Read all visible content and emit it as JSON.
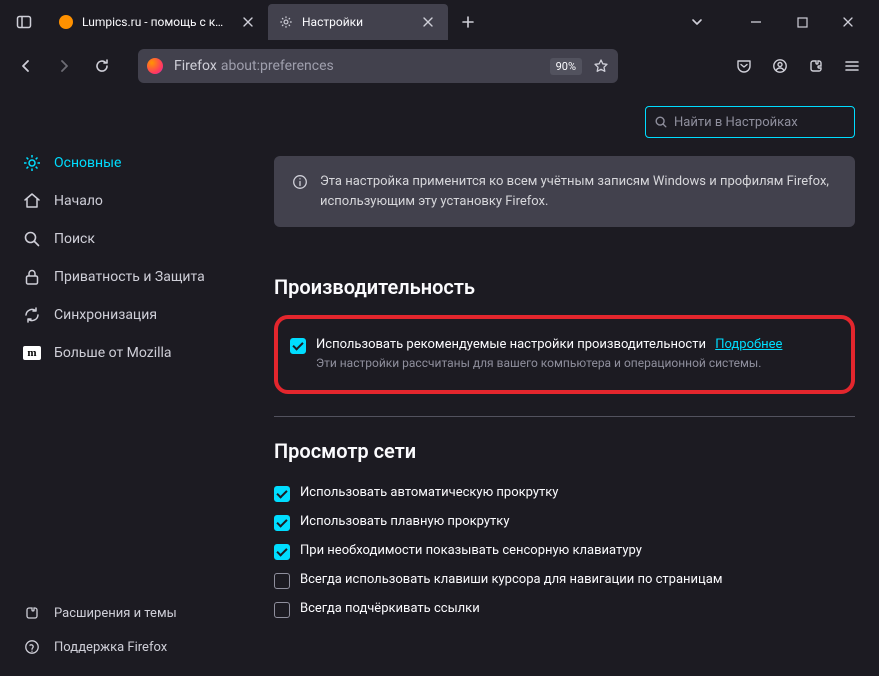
{
  "tabs": [
    {
      "label": "Lumpics.ru - помощь с компь",
      "icon": "orange"
    },
    {
      "label": "Настройки",
      "icon": "gear"
    }
  ],
  "urlbar": {
    "identity": "Firefox",
    "path": "about:preferences",
    "zoom": "90%"
  },
  "search": {
    "placeholder": "Найти в Настройках"
  },
  "categories": [
    {
      "id": "general",
      "label": "Основные",
      "icon": "gear",
      "active": true
    },
    {
      "id": "home",
      "label": "Начало",
      "icon": "home",
      "active": false
    },
    {
      "id": "search",
      "label": "Поиск",
      "icon": "search",
      "active": false
    },
    {
      "id": "privacy",
      "label": "Приватность и Защита",
      "icon": "lock",
      "active": false
    },
    {
      "id": "sync",
      "label": "Синхронизация",
      "icon": "sync",
      "active": false
    },
    {
      "id": "more",
      "label": "Больше от Mozilla",
      "icon": "mozilla",
      "active": false
    }
  ],
  "bottom_links": [
    {
      "id": "extensions",
      "label": "Расширения и темы",
      "icon": "puzzle"
    },
    {
      "id": "support",
      "label": "Поддержка Firefox",
      "icon": "question"
    }
  ],
  "banner": "Эта настройка применится ко всем учётным записям Windows и профилям Firefox, использующим эту установку Firefox.",
  "sections": {
    "performance": {
      "heading": "Производительность",
      "checkbox_label": "Использовать рекомендуемые настройки производительности",
      "learn_more": "Подробнее",
      "description": "Эти настройки рассчитаны для вашего компьютера и операционной системы."
    },
    "browsing": {
      "heading": "Просмотр сети",
      "items": [
        {
          "label": "Использовать автоматическую прокрутку",
          "checked": true
        },
        {
          "label": "Использовать плавную прокрутку",
          "checked": true
        },
        {
          "label": "При необходимости показывать сенсорную клавиатуру",
          "checked": true
        },
        {
          "label": "Всегда использовать клавиши курсора для навигации по страницам",
          "checked": false
        },
        {
          "label": "Всегда подчёркивать ссылки",
          "checked": false
        }
      ]
    }
  }
}
